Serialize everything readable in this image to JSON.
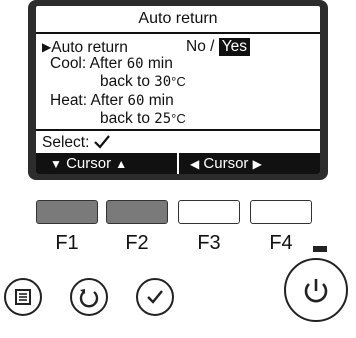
{
  "screen": {
    "title": "Auto return",
    "auto_return_label": "Auto return",
    "no_option": "No",
    "separator": "/",
    "yes_option": "Yes",
    "cool_prefix": "Cool: After",
    "cool_minutes": "60",
    "min_unit": "min",
    "back_to": "back to",
    "cool_temp": "30",
    "temp_unit": "°C",
    "heat_prefix": "Heat: After",
    "heat_minutes": "60",
    "heat_temp": "25",
    "select_label": "Select:",
    "cursor_label": "Cursor"
  },
  "function_keys": [
    "F1",
    "F2",
    "F3",
    "F4"
  ],
  "icons": {
    "selected_marker": "triangle-right-icon",
    "select": "checkmark-icon",
    "cursor_down": "triangle-down-icon",
    "cursor_up": "triangle-up-icon",
    "cursor_left": "triangle-left-icon",
    "cursor_right": "triangle-right-icon",
    "menu_button": "menu-icon",
    "return_button": "return-arrow-icon",
    "select_button": "checkmark-icon",
    "power_button": "power-icon"
  },
  "colors": {
    "frame": "#2c2c2c",
    "active_fkey": "#7a7a7a",
    "lcd_text": "#111111"
  }
}
